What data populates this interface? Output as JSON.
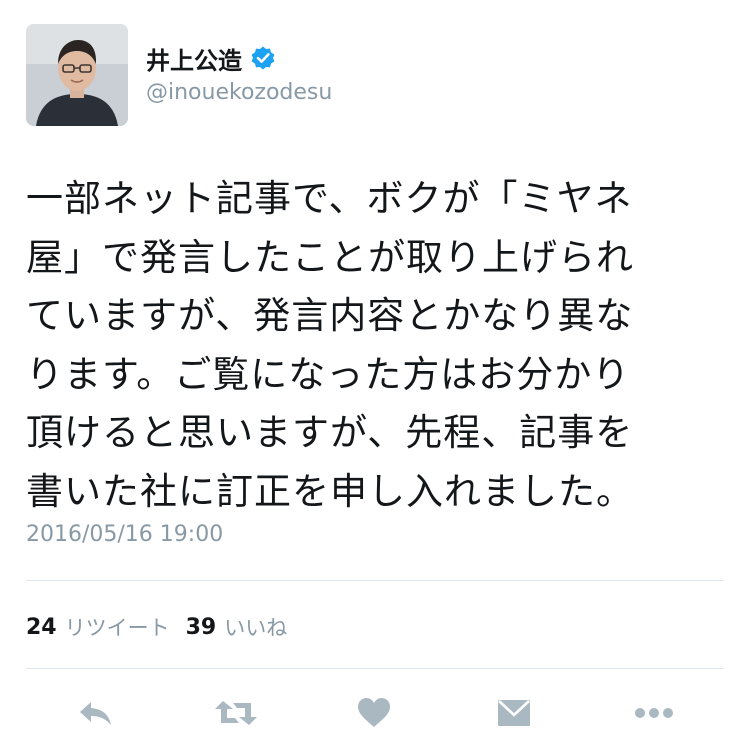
{
  "author": {
    "display_name": "井上公造",
    "handle": "@inouekozodesu",
    "verified": true,
    "avatar_icon": "person-photo-icon"
  },
  "tweet": {
    "lines": [
      "一部ネット記事で、ボクが「ミヤネ",
      "屋」で発言したことが取り上げられ",
      "ていますが、発言内容とかなり異な",
      "ります。ご覧になった方はお分かり",
      "頂けると思いますが、先程、記事を",
      "書いた社に訂正を申し入れました。"
    ],
    "timestamp": "2016/05/16 19:00"
  },
  "stats": {
    "retweets_count": "24",
    "retweets_label": "リツイート",
    "likes_count": "39",
    "likes_label": "いいね"
  },
  "actions": [
    {
      "name": "reply",
      "icon": "reply-icon"
    },
    {
      "name": "retweet",
      "icon": "retweet-icon"
    },
    {
      "name": "like",
      "icon": "heart-icon"
    },
    {
      "name": "direct-message",
      "icon": "envelope-icon"
    },
    {
      "name": "more",
      "icon": "more-dots-icon"
    }
  ],
  "colors": {
    "text": "#14171a",
    "secondary": "#8899a6",
    "icon": "#aab8c2",
    "verified": "#1da1f2",
    "divider": "#e1e8ed"
  }
}
